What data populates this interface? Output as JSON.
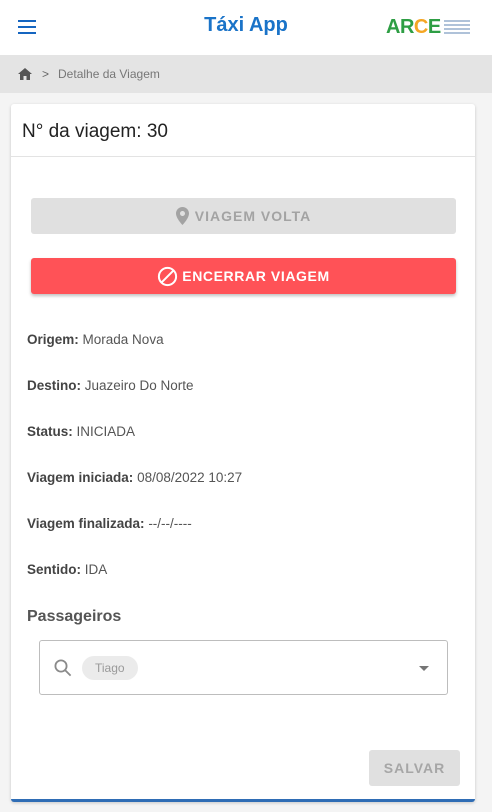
{
  "header": {
    "title": "Táxi App",
    "logo_text_ar": "AR",
    "logo_text_c": "C",
    "logo_text_e": "E",
    "menu_icon": "hamburger-menu-icon"
  },
  "breadcrumb": {
    "home_icon": "home-icon",
    "separator": ">",
    "current": "Detalhe da Viagem"
  },
  "trip": {
    "title": "N° da viagem: 30",
    "return_button": "VIAGEM VOLTA",
    "end_button": "ENCERRAR VIAGEM",
    "fields": [
      {
        "label": "Origem:",
        "value": "Morada Nova"
      },
      {
        "label": "Destino:",
        "value": "Juazeiro Do Norte"
      },
      {
        "label": "Status:",
        "value": "INICIADA"
      },
      {
        "label": "Viagem iniciada:",
        "value": "08/08/2022 10:27"
      },
      {
        "label": "Viagem finalizada:",
        "value": "--/--/----"
      },
      {
        "label": "Sentido:",
        "value": "IDA"
      }
    ]
  },
  "passengers": {
    "title": "Passageiros",
    "selected_chip": "Tiago"
  },
  "save_button": "SALVAR",
  "colors": {
    "brand_blue": "#1a73c8",
    "danger": "#ff5257",
    "disabled": "#e0e0e0"
  }
}
